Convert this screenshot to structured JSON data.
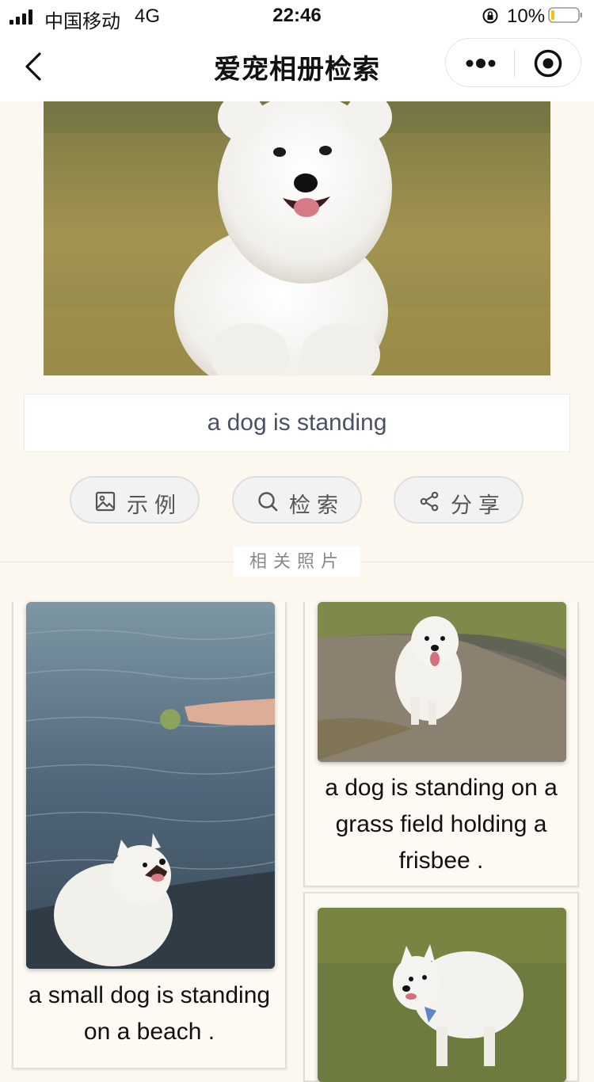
{
  "status_bar": {
    "carrier": "中国移动",
    "network": "4G",
    "time": "22:46",
    "battery": "10%"
  },
  "nav": {
    "title": "爱宠相册检索",
    "back_icon": "chevron-left-icon",
    "more_icon": "more-dots-icon",
    "close_icon": "target-circle-icon"
  },
  "query": {
    "text": "a dog is standing"
  },
  "actions": [
    {
      "label": "示例",
      "icon": "image-icon"
    },
    {
      "label": "检索",
      "icon": "search-icon"
    },
    {
      "label": "分享",
      "icon": "share-icon"
    }
  ],
  "section": {
    "title": "相关照片"
  },
  "results": [
    {
      "caption": "a small dog is standing on a beach ."
    },
    {
      "caption": "a dog is standing on a grass field holding a frisbee ."
    },
    {
      "caption": ""
    }
  ],
  "colors": {
    "page_bg": "#fdf8ef",
    "button_bg": "#f2f2f2",
    "button_text": "#555555"
  }
}
